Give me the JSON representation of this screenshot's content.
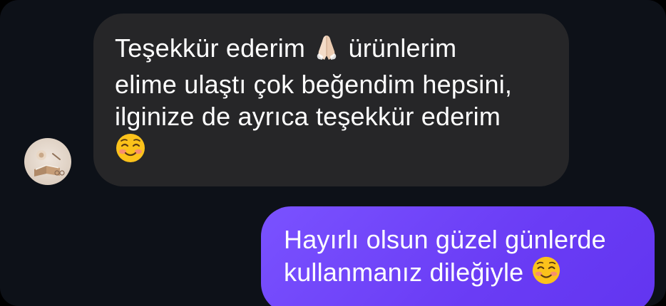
{
  "messages": [
    {
      "direction": "incoming",
      "lines": [
        "Teşekkür ederim",
        "ürünlerim",
        "elime ulaştı çok beğendim hepsini,",
        "ilginize de ayrıca teşekkür ederim"
      ],
      "emojis": [
        "folded-hands",
        "smiling-face"
      ]
    },
    {
      "direction": "outgoing",
      "lines": [
        "Hayırlı olsun güzel günlerde",
        "kullanmanız dileğiyle"
      ],
      "emojis": [
        "smiling-face"
      ]
    }
  ],
  "colors": {
    "background": "#0d1118",
    "incoming_bubble": "#262628",
    "outgoing_bubble": "#6a3cf5",
    "text": "#ffffff"
  }
}
